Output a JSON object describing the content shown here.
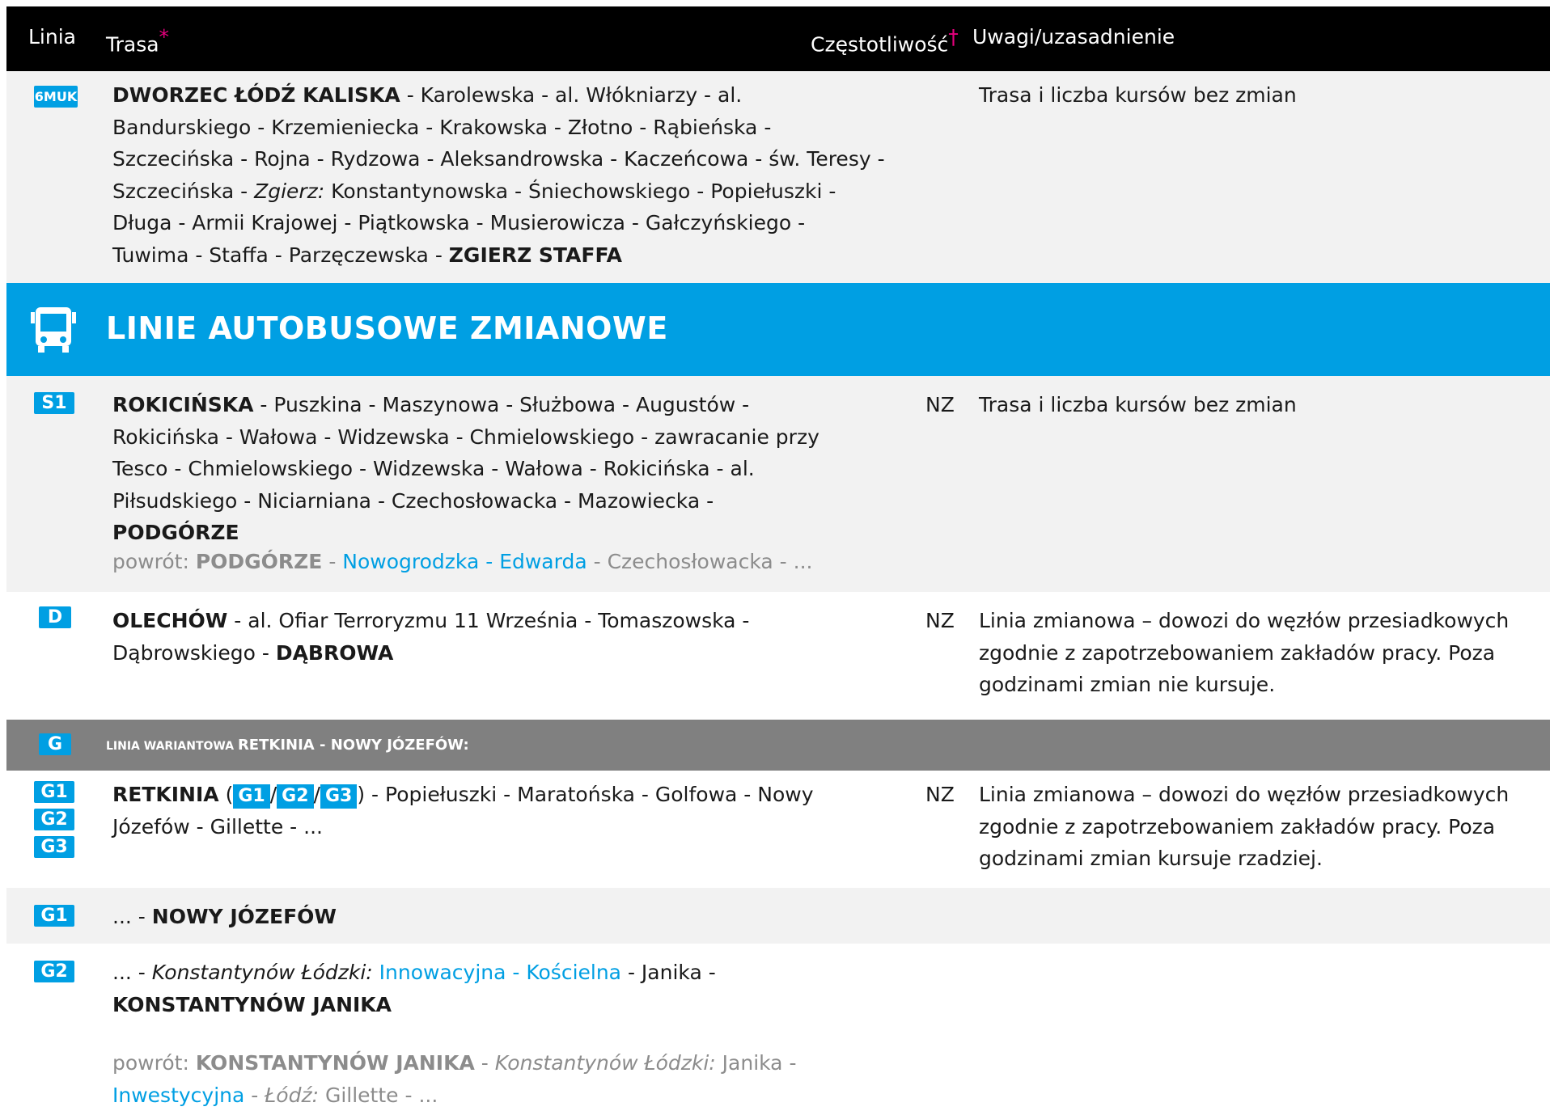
{
  "header": {
    "col_line": "Linia",
    "col_route": "Trasa",
    "route_mark": "*",
    "col_freq": "Częstotliwość",
    "freq_mark": "†",
    "col_notes": "Uwagi/uzasadnienie"
  },
  "row_6muk": {
    "badge": "6MUK",
    "route_start": "DWORZEC ŁÓDŹ KALISKA",
    "route_a": " - Karolewska - al. Włókniarzy - al. Bandurskiego - Krzemieniecka - Krakowska - Złotno - Rąbieńska - Szczecińska - Rojna - Rydzowa - Aleksandrowska - Kaczeńcowa - św. Teresy - Szczecińska - ",
    "route_italic": "Zgierz:",
    "route_b": " Konstantynowska - Śniechowskiego - Popiełuszki - Długa - Armii Krajowej - Piątkowska - Musierowicza - Gałczyńskiego - Tuwima - Staffa - Parzęczewska - ",
    "route_end": "ZGIERZ STAFFA",
    "notes": "Trasa i liczba kursów bez zmian"
  },
  "section_bus": {
    "title": "LINIE AUTOBUSOWE ZMIANOWE"
  },
  "row_s1": {
    "badge": "S1",
    "route_start": "ROKICIŃSKA",
    "route_mid": " - Puszkina - Maszynowa - Służbowa - Augustów - Rokicińska - Wałowa - Widzewska - Chmielowskiego - zawracanie przy Tesco - Chmielowskiego - Widzewska - Wałowa - Rokicińska - al. Piłsudskiego - Niciarniana - Czechosłowacka - Mazowiecka - ",
    "route_end": "PODGÓRZE",
    "freq": "NZ",
    "notes": "Trasa i liczba kursów bez zmian",
    "return_label": "powrót: ",
    "return_start": "PODGÓRZE",
    "return_sep": " - ",
    "return_blue": "Nowogrodzka - Edwarda",
    "return_rest": " - Czechosłowacka - ..."
  },
  "row_d": {
    "badge": "D",
    "route_start": "OLECHÓW",
    "route_mid": " - al. Ofiar Terroryzmu 11 Września - Tomaszowska - Dąbrowskiego - ",
    "route_end": "DĄBROWA",
    "freq": "NZ",
    "notes": "Linia zmianowa – dowozi do węzłów przesiadkowych zgodnie z zapotrzebowaniem zakładów pracy. Poza godzinami zmian nie kursuje."
  },
  "row_g": {
    "badge": "G",
    "title_a": "LINIA WARIANTOWA ",
    "title_b": "RETKINIA - NOWY JÓZEFÓW:"
  },
  "row_g123": {
    "badges": [
      "G1",
      "G2",
      "G3"
    ],
    "route_start": "RETKINIA",
    "open": " (",
    "slash": "/",
    "close": ")",
    "route_rest": " - Popiełuszki - Maratońska - Golfowa - Nowy Józefów - Gillette - ...",
    "freq": "NZ",
    "notes": "Linia zmianowa – dowozi do węzłów przesiadkowych zgodnie z zapotrzebowaniem zakładów pracy. Poza godzinami zmian kursuje rzadziej."
  },
  "row_g1": {
    "badge": "G1",
    "prefix": "... - ",
    "route_end": "NOWY JÓZEFÓW"
  },
  "row_g2": {
    "badge": "G2",
    "prefix": "... - ",
    "italic": "Konstantynów Łódzki:",
    "blue": " Innowacyjna - Kościelna",
    "mid": " - Janika - ",
    "route_end": "KONSTANTYNÓW JANIKA",
    "return_label": "powrót: ",
    "return_start": "KONSTANTYNÓW JANIKA",
    "return_sep": " - ",
    "return_italic": "Konstantynów Łódzki:",
    "return_a": " Janika - ",
    "return_blue": "Inwestycyjna",
    "return_sep2": " - ",
    "return_italic2": "Łódź:",
    "return_b": " Gillette - ..."
  },
  "colors": {
    "accent": "#009fe3",
    "header_bg": "#000000",
    "variant_band": "#808080",
    "row_gray": "#f2f2f2",
    "mark": "#e5007d"
  },
  "icons": {
    "bus": "bus-icon"
  }
}
